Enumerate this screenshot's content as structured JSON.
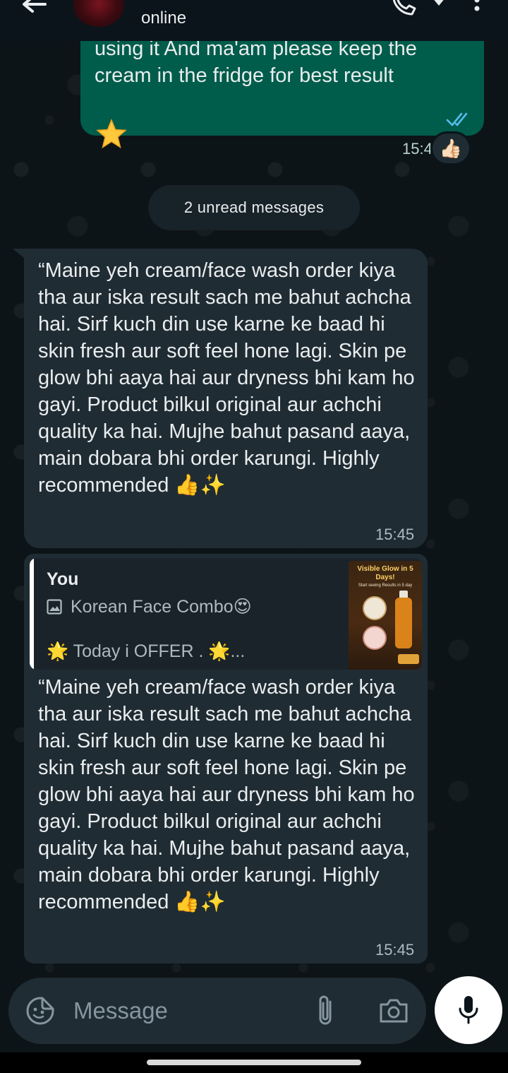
{
  "header": {
    "status": "online",
    "icons": [
      "back-arrow-icon",
      "avatar",
      "phone-icon",
      "video-icon",
      "more-vert-icon"
    ]
  },
  "messages": [
    {
      "direction": "outgoing",
      "text": "using it And ma'am please keep the cream in the fridge for best result",
      "emoji": "⭐",
      "time": "15:43",
      "status": "read",
      "reaction": "👍🏻"
    },
    {
      "direction": "incoming",
      "text": "“Maine yeh cream/face wash order kiya tha aur iska result sach me bahut achcha hai. Sirf kuch din use karne ke baad hi skin fresh aur soft feel hone lagi. Skin pe glow bhi aaya hai aur dryness bhi kam ho gayi. Product bilkul original aur achchi quality ka hai. Mujhe bahut pasand aaya, main dobara bhi order karungi. Highly recommended 👍✨",
      "time": "15:45"
    },
    {
      "direction": "incoming",
      "quote": {
        "author": "You",
        "line1": "Korean Face Combo😍",
        "line2": "🌟 Today i OFFER . 🌟...",
        "thumb_title": "Visible Glow in 5 Days!",
        "thumb_subtitle": "Start seeing Results in 5 day"
      },
      "text": "“Maine yeh cream/face wash order kiya tha aur iska result sach me bahut achcha hai. Sirf kuch din use karne ke baad hi skin fresh aur soft feel hone lagi. Skin pe glow bhi aaya hai aur dryness bhi kam ho gayi. Product bilkul original aur achchi quality ka hai. Mujhe bahut pasand aaya, main dobara bhi order karungi. Highly recommended 👍✨",
      "time": "15:45"
    }
  ],
  "unread_label": "2 unread messages",
  "composer": {
    "placeholder": "Message",
    "icons": [
      "emoji-sticker-icon",
      "attach-icon",
      "camera-icon",
      "mic-icon"
    ]
  },
  "colors": {
    "background": "#0b141a",
    "outgoing_bubble": "#005c4b",
    "incoming_bubble": "#202c33",
    "read_check": "#53bdeb",
    "text": "#e9edef",
    "meta_text": "#aebac1"
  }
}
